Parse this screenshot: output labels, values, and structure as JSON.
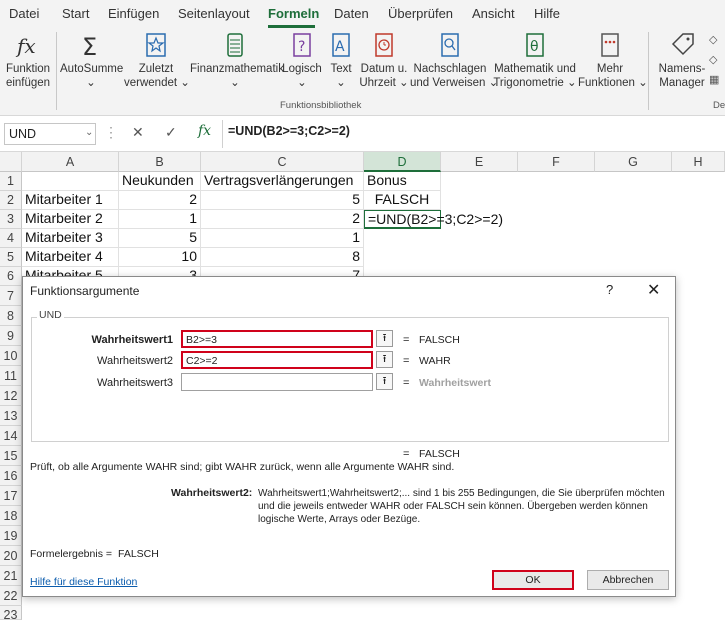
{
  "menu": {
    "items": [
      "Datei",
      "Start",
      "Einfügen",
      "Seitenlayout",
      "Formeln",
      "Daten",
      "Überprüfen",
      "Ansicht",
      "Hilfe"
    ],
    "active": "Formeln"
  },
  "ribbon": {
    "insert_function": [
      "Funktion",
      "einfügen"
    ],
    "autosum": [
      "AutoSumme",
      "⌄"
    ],
    "recent": [
      "Zuletzt",
      "verwendet ⌄"
    ],
    "financial": [
      "Finanzmathematik",
      "⌄"
    ],
    "logical": [
      "Logisch",
      "⌄"
    ],
    "text": [
      "Text",
      "⌄"
    ],
    "datetime": [
      "Datum u.",
      "Uhrzeit ⌄"
    ],
    "lookup": [
      "Nachschlagen",
      "und Verweisen ⌄"
    ],
    "math": [
      "Mathematik und",
      "Trigonometrie ⌄"
    ],
    "more": [
      "Mehr",
      "Funktionen ⌄"
    ],
    "namesmanager": [
      "Namens-",
      "Manager"
    ],
    "group_label": "Funktionsbibliothek",
    "cut_label": "De"
  },
  "formula_bar": {
    "name_box": "UND",
    "formula": "=UND(B2>=3;C2>=2)"
  },
  "grid": {
    "columns": [
      "A",
      "B",
      "C",
      "D",
      "E",
      "F",
      "G",
      "H"
    ],
    "selected_column": "D",
    "rows": [
      "1",
      "2",
      "3",
      "4",
      "5",
      "6",
      "7",
      "8",
      "9",
      "10",
      "11",
      "12",
      "13",
      "14",
      "15",
      "16",
      "17",
      "18",
      "19",
      "20",
      "21",
      "22",
      "23"
    ],
    "header_row": {
      "b": "Neukunden",
      "c": "Vertragsverlängerungen",
      "d": "Bonus"
    },
    "data_rows": [
      {
        "a": "Mitarbeiter 1",
        "b": "2",
        "c": "5",
        "d": "FALSCH"
      },
      {
        "a": "Mitarbeiter 2",
        "b": "1",
        "c": "2",
        "d": "=UND(B2>=3;C2>=2)"
      },
      {
        "a": "Mitarbeiter 3",
        "b": "5",
        "c": "1",
        "d": ""
      },
      {
        "a": "Mitarbeiter 4",
        "b": "10",
        "c": "8",
        "d": ""
      },
      {
        "a": "Mitarbeiter 5",
        "b": "3",
        "c": "7",
        "d": ""
      }
    ]
  },
  "dialog": {
    "title": "Funktionsargumente",
    "help": "?",
    "close": "✕",
    "function_name": "UND",
    "args": [
      {
        "label": "Wahrheitswert1",
        "value": "B2>=3",
        "result": "FALSCH"
      },
      {
        "label": "Wahrheitswert2",
        "value": "C2>=2",
        "result": "WAHR"
      },
      {
        "label": "Wahrheitswert3",
        "value": "",
        "result": "Wahrheitswert"
      }
    ],
    "picker_glyph": "⭱",
    "equals": "=",
    "overall_result": "FALSCH",
    "description": "Prüft, ob alle Argumente WAHR sind; gibt WAHR zurück, wenn alle Argumente WAHR sind.",
    "arg_desc_label": "Wahrheitswert2:",
    "arg_desc_text": "Wahrheitswert1;Wahrheitswert2;... sind 1 bis 255 Bedingungen, die Sie überprüfen möchten und die jeweils entweder WAHR oder FALSCH sein können. Übergeben werden können logische Werte, Arrays oder Bezüge.",
    "formula_result_label": "Formelergebnis =",
    "formula_result_value": "FALSCH",
    "help_link": "Hilfe für diese Funktion",
    "ok": "OK",
    "cancel": "Abbrechen"
  },
  "colors": {
    "accent": "#1e6e3a",
    "highlight": "#d0021b",
    "link": "#0b5cad"
  }
}
